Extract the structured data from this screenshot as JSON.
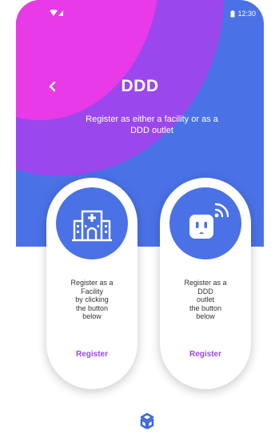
{
  "status_bar": {
    "time": "12:30"
  },
  "header": {
    "title": "DDD",
    "subtitle": "Register as either a facility or as a DDD outlet"
  },
  "cards": [
    {
      "icon": "hospital-building-icon",
      "description": "Register as a\nFacility\nby clicking\nthe button\nbelow",
      "button_label": "Register"
    },
    {
      "icon": "smart-outlet-icon",
      "description": "Register as a\nDDD\noutlet\nthe button\nbelow",
      "button_label": "Register"
    }
  ],
  "colors": {
    "primary_blue": "#4a72e6",
    "purple": "#9b47ee",
    "pink": "#e83ae6"
  }
}
